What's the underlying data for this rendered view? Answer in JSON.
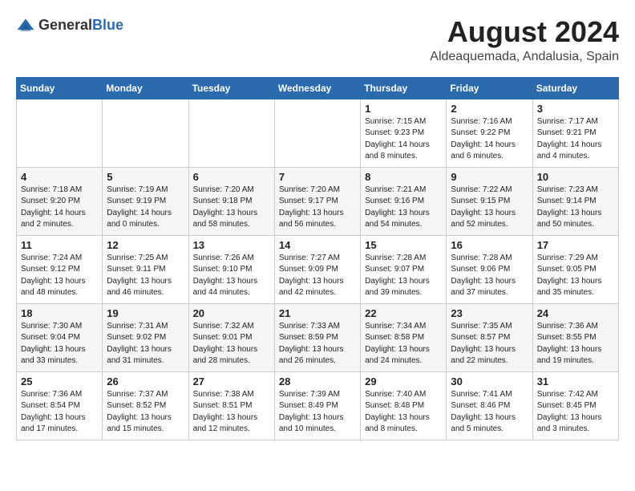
{
  "logo": {
    "text_general": "General",
    "text_blue": "Blue"
  },
  "title": {
    "month_year": "August 2024",
    "location": "Aldeaquemada, Andalusia, Spain"
  },
  "headers": [
    "Sunday",
    "Monday",
    "Tuesday",
    "Wednesday",
    "Thursday",
    "Friday",
    "Saturday"
  ],
  "weeks": [
    {
      "days": [
        {
          "num": "",
          "info": ""
        },
        {
          "num": "",
          "info": ""
        },
        {
          "num": "",
          "info": ""
        },
        {
          "num": "",
          "info": ""
        },
        {
          "num": "1",
          "info": "Sunrise: 7:15 AM\nSunset: 9:23 PM\nDaylight: 14 hours\nand 8 minutes."
        },
        {
          "num": "2",
          "info": "Sunrise: 7:16 AM\nSunset: 9:22 PM\nDaylight: 14 hours\nand 6 minutes."
        },
        {
          "num": "3",
          "info": "Sunrise: 7:17 AM\nSunset: 9:21 PM\nDaylight: 14 hours\nand 4 minutes."
        }
      ]
    },
    {
      "days": [
        {
          "num": "4",
          "info": "Sunrise: 7:18 AM\nSunset: 9:20 PM\nDaylight: 14 hours\nand 2 minutes."
        },
        {
          "num": "5",
          "info": "Sunrise: 7:19 AM\nSunset: 9:19 PM\nDaylight: 14 hours\nand 0 minutes."
        },
        {
          "num": "6",
          "info": "Sunrise: 7:20 AM\nSunset: 9:18 PM\nDaylight: 13 hours\nand 58 minutes."
        },
        {
          "num": "7",
          "info": "Sunrise: 7:20 AM\nSunset: 9:17 PM\nDaylight: 13 hours\nand 56 minutes."
        },
        {
          "num": "8",
          "info": "Sunrise: 7:21 AM\nSunset: 9:16 PM\nDaylight: 13 hours\nand 54 minutes."
        },
        {
          "num": "9",
          "info": "Sunrise: 7:22 AM\nSunset: 9:15 PM\nDaylight: 13 hours\nand 52 minutes."
        },
        {
          "num": "10",
          "info": "Sunrise: 7:23 AM\nSunset: 9:14 PM\nDaylight: 13 hours\nand 50 minutes."
        }
      ]
    },
    {
      "days": [
        {
          "num": "11",
          "info": "Sunrise: 7:24 AM\nSunset: 9:12 PM\nDaylight: 13 hours\nand 48 minutes."
        },
        {
          "num": "12",
          "info": "Sunrise: 7:25 AM\nSunset: 9:11 PM\nDaylight: 13 hours\nand 46 minutes."
        },
        {
          "num": "13",
          "info": "Sunrise: 7:26 AM\nSunset: 9:10 PM\nDaylight: 13 hours\nand 44 minutes."
        },
        {
          "num": "14",
          "info": "Sunrise: 7:27 AM\nSunset: 9:09 PM\nDaylight: 13 hours\nand 42 minutes."
        },
        {
          "num": "15",
          "info": "Sunrise: 7:28 AM\nSunset: 9:07 PM\nDaylight: 13 hours\nand 39 minutes."
        },
        {
          "num": "16",
          "info": "Sunrise: 7:28 AM\nSunset: 9:06 PM\nDaylight: 13 hours\nand 37 minutes."
        },
        {
          "num": "17",
          "info": "Sunrise: 7:29 AM\nSunset: 9:05 PM\nDaylight: 13 hours\nand 35 minutes."
        }
      ]
    },
    {
      "days": [
        {
          "num": "18",
          "info": "Sunrise: 7:30 AM\nSunset: 9:04 PM\nDaylight: 13 hours\nand 33 minutes."
        },
        {
          "num": "19",
          "info": "Sunrise: 7:31 AM\nSunset: 9:02 PM\nDaylight: 13 hours\nand 31 minutes."
        },
        {
          "num": "20",
          "info": "Sunrise: 7:32 AM\nSunset: 9:01 PM\nDaylight: 13 hours\nand 28 minutes."
        },
        {
          "num": "21",
          "info": "Sunrise: 7:33 AM\nSunset: 8:59 PM\nDaylight: 13 hours\nand 26 minutes."
        },
        {
          "num": "22",
          "info": "Sunrise: 7:34 AM\nSunset: 8:58 PM\nDaylight: 13 hours\nand 24 minutes."
        },
        {
          "num": "23",
          "info": "Sunrise: 7:35 AM\nSunset: 8:57 PM\nDaylight: 13 hours\nand 22 minutes."
        },
        {
          "num": "24",
          "info": "Sunrise: 7:36 AM\nSunset: 8:55 PM\nDaylight: 13 hours\nand 19 minutes."
        }
      ]
    },
    {
      "days": [
        {
          "num": "25",
          "info": "Sunrise: 7:36 AM\nSunset: 8:54 PM\nDaylight: 13 hours\nand 17 minutes."
        },
        {
          "num": "26",
          "info": "Sunrise: 7:37 AM\nSunset: 8:52 PM\nDaylight: 13 hours\nand 15 minutes."
        },
        {
          "num": "27",
          "info": "Sunrise: 7:38 AM\nSunset: 8:51 PM\nDaylight: 13 hours\nand 12 minutes."
        },
        {
          "num": "28",
          "info": "Sunrise: 7:39 AM\nSunset: 8:49 PM\nDaylight: 13 hours\nand 10 minutes."
        },
        {
          "num": "29",
          "info": "Sunrise: 7:40 AM\nSunset: 8:48 PM\nDaylight: 13 hours\nand 8 minutes."
        },
        {
          "num": "30",
          "info": "Sunrise: 7:41 AM\nSunset: 8:46 PM\nDaylight: 13 hours\nand 5 minutes."
        },
        {
          "num": "31",
          "info": "Sunrise: 7:42 AM\nSunset: 8:45 PM\nDaylight: 13 hours\nand 3 minutes."
        }
      ]
    }
  ]
}
